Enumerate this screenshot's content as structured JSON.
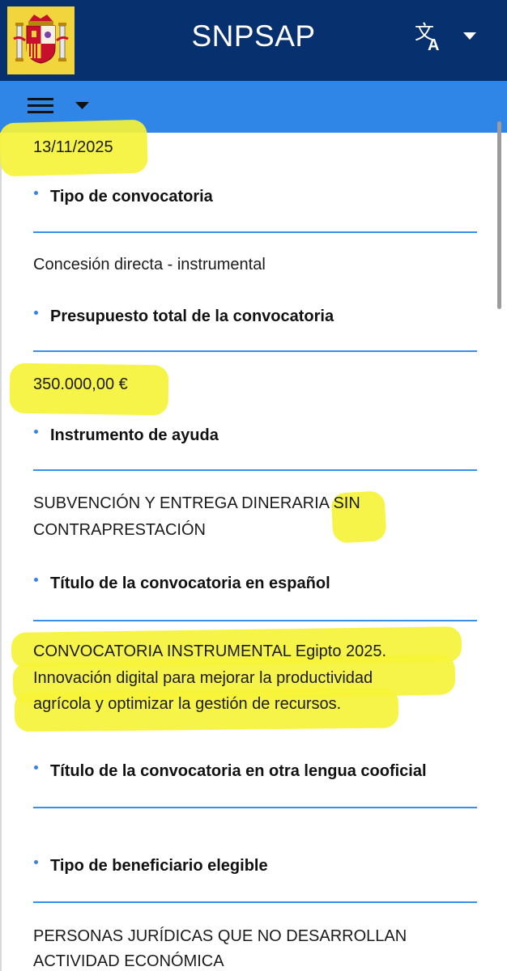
{
  "header": {
    "title": "SNPSAP",
    "logo": "coat-of-arms-of-spain",
    "language_icon": "translate-icon",
    "colors": {
      "topbar": "#07306f",
      "navbar": "#2f86e6",
      "rule": "#3b8fe8",
      "highlight": "#f6f33a"
    }
  },
  "nav": {
    "menu_icon": "hamburger-menu-icon",
    "dropdown_icon": "caret-down-icon"
  },
  "fields": {
    "date": "13/11/2025",
    "tipo_label": "Tipo de convocatoria",
    "tipo_value": "Concesión directa - instrumental",
    "presupuesto_label": "Presupuesto total de la convocatoria",
    "presupuesto_value": "350.000,00 €",
    "instrumento_label": "Instrumento de ayuda",
    "instrumento_value_l1": "SUBVENCIÓN Y ENTREGA DINERARIA SIN",
    "instrumento_value_l2": "CONTRAPRESTACIÓN",
    "titulo_es_label": "Título de la convocatoria en español",
    "titulo_es_l1": "CONVOCATORIA INSTRUMENTAL Egipto 2025.",
    "titulo_es_l2": "Innovación digital para mejorar la productividad",
    "titulo_es_l3": "agrícola y optimizar la gestión de recursos.",
    "titulo_otra_label": "Título de la convocatoria en otra lengua cooficial",
    "beneficiario_label": "Tipo de beneficiario elegible",
    "beneficiario_l1": "PERSONAS JURÍDICAS QUE NO DESARROLLAN",
    "beneficiario_l2": "ACTIVIDAD ECONÓMICA"
  }
}
